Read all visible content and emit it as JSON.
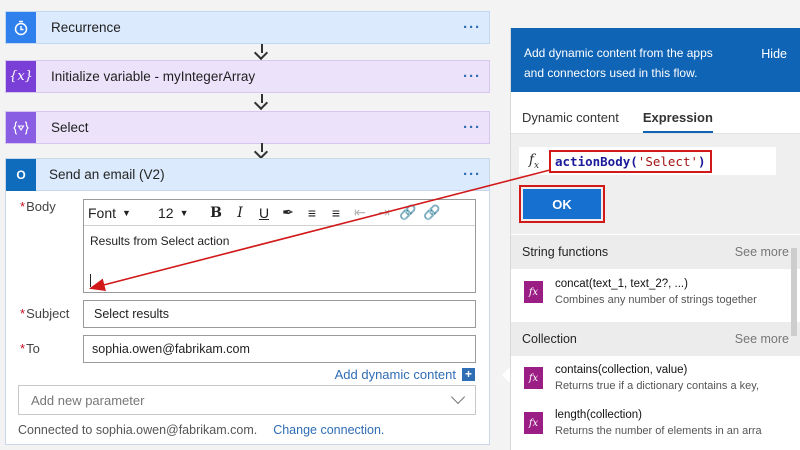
{
  "flow": {
    "steps": [
      {
        "title": "Recurrence",
        "icon": "clock-icon",
        "more": "···"
      },
      {
        "title": "Initialize variable - myIntegerArray",
        "icon": "variable-icon",
        "more": "···"
      },
      {
        "title": "Select",
        "icon": "data-operation-icon",
        "more": "···"
      }
    ],
    "email": {
      "title": "Send an email (V2)",
      "more": "···",
      "body_label": "Body",
      "toolbar": {
        "font": "Font",
        "size": "12"
      },
      "body_text": "Results from Select action",
      "subject_label": "Subject",
      "subject_value": "Select results",
      "to_label": "To",
      "to_value": "sophia.owen@fabrikam.com",
      "add_dynamic": "Add dynamic content",
      "add_param_placeholder": "Add new parameter",
      "connected": "Connected to sophia.owen@fabrikam.com.",
      "change_connection": "Change connection."
    }
  },
  "panel": {
    "header_line1": "Add dynamic content from the apps",
    "header_line2": "and connectors used in this flow.",
    "hide": "Hide",
    "tabs": [
      "Dynamic content",
      "Expression"
    ],
    "expression_fn": "actionBody(",
    "expression_arg": "'Select'",
    "expression_close": ")",
    "ok": "OK",
    "sections": [
      {
        "name": "String functions",
        "see_more": "See more",
        "items": [
          {
            "name": "concat(text_1, text_2?, ...)",
            "desc": "Combines any number of strings together"
          }
        ]
      },
      {
        "name": "Collection",
        "see_more": "See more",
        "items": [
          {
            "name": "contains(collection, value)",
            "desc": "Returns true if a dictionary contains a key,"
          },
          {
            "name": "length(collection)",
            "desc": "Returns the number of elements in an arra"
          }
        ]
      }
    ]
  },
  "colors": {
    "accent": "#0f64b6",
    "highlight": "#d21919",
    "function_badge": "#9b1e84"
  }
}
